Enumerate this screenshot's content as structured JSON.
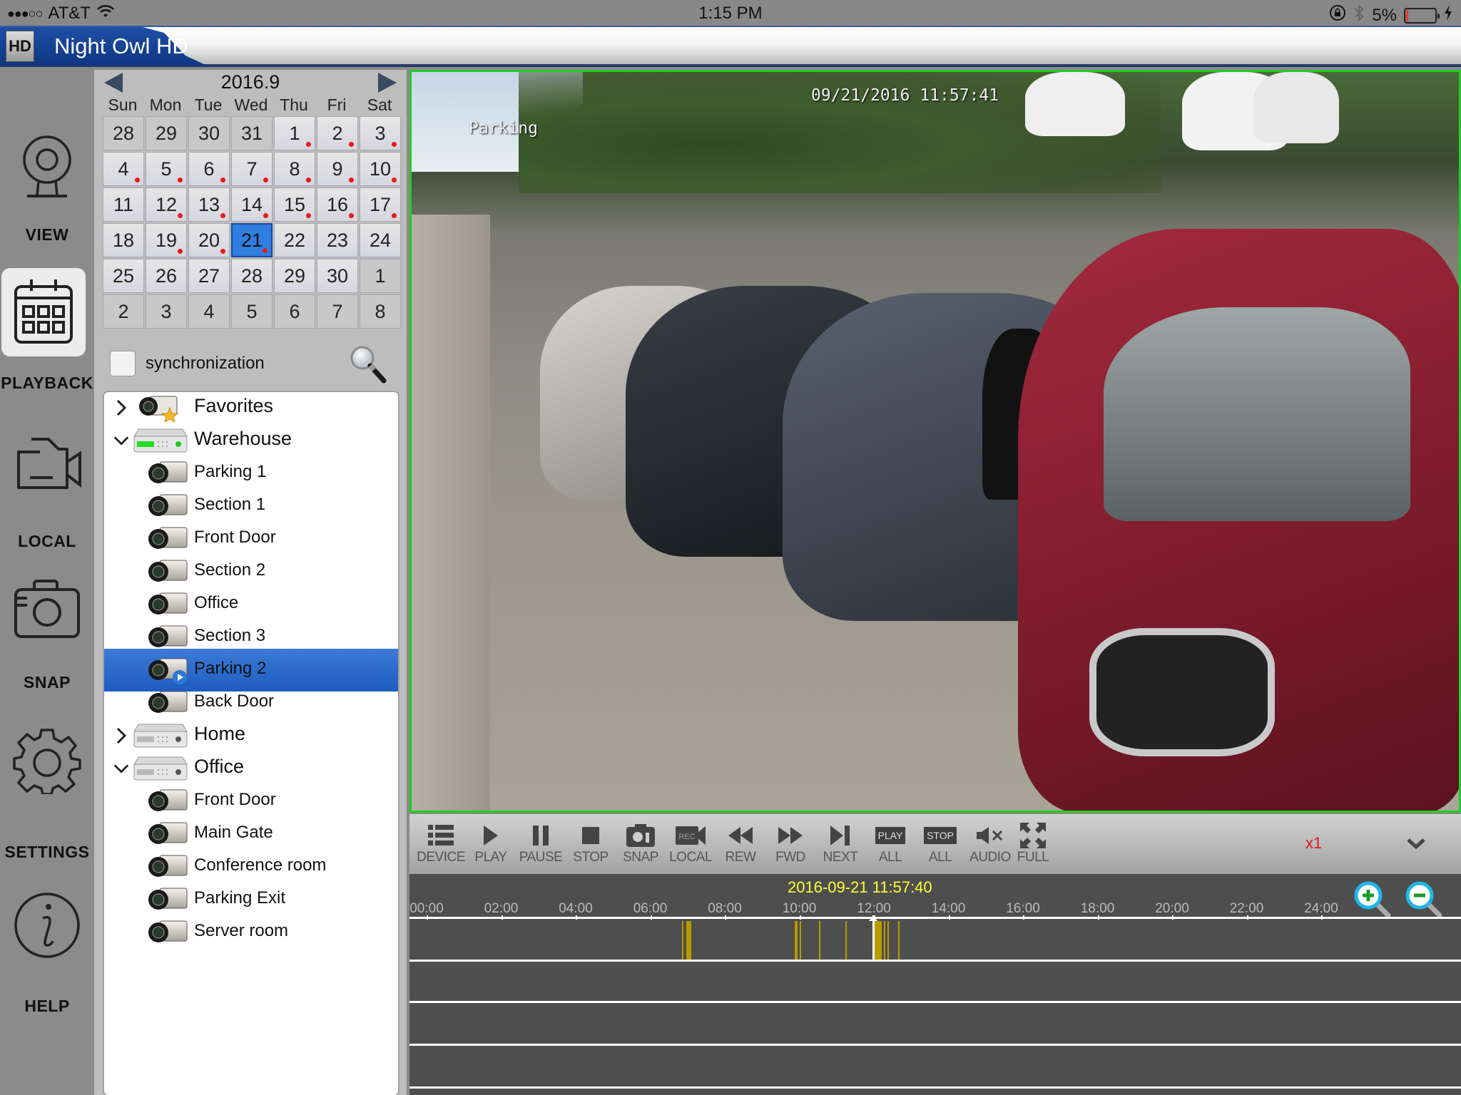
{
  "status_bar": {
    "signal": "●●●○○",
    "carrier": "AT&T",
    "wifi_icon": "wifi-icon",
    "time": "1:15 PM",
    "rotation_lock_icon": "rotation-lock-icon",
    "bluetooth_icon": "bluetooth-icon",
    "battery_percent": "5%",
    "battery_level": 0.05,
    "charging_icon": "charging-bolt-icon"
  },
  "app": {
    "title": "Night Owl HD",
    "logo_text": "HD"
  },
  "nav": {
    "items": [
      {
        "id": "view",
        "label": "VIEW",
        "icon": "webcam-icon",
        "active": false
      },
      {
        "id": "playback",
        "label": "PLAYBACK",
        "icon": "calendar-icon",
        "active": true
      },
      {
        "id": "local",
        "label": "LOCAL",
        "icon": "video-folder-icon",
        "active": false
      },
      {
        "id": "snap",
        "label": "SNAP",
        "icon": "camera-icon",
        "active": false
      },
      {
        "id": "settings",
        "label": "SETTINGS",
        "icon": "gear-icon",
        "active": false
      },
      {
        "id": "help",
        "label": "HELP",
        "icon": "info-icon",
        "active": false
      }
    ]
  },
  "calendar": {
    "title": "2016.9",
    "days_of_week": [
      "Sun",
      "Mon",
      "Tue",
      "Wed",
      "Thu",
      "Fri",
      "Sat"
    ],
    "selected_day": 21,
    "weeks": [
      [
        {
          "d": "28",
          "o": true
        },
        {
          "d": "29",
          "o": true
        },
        {
          "d": "30",
          "o": true
        },
        {
          "d": "31",
          "o": true
        },
        {
          "d": "1",
          "r": true
        },
        {
          "d": "2",
          "r": true
        },
        {
          "d": "3",
          "r": true
        }
      ],
      [
        {
          "d": "4",
          "r": true
        },
        {
          "d": "5",
          "r": true
        },
        {
          "d": "6",
          "r": true
        },
        {
          "d": "7",
          "r": true
        },
        {
          "d": "8",
          "r": true
        },
        {
          "d": "9",
          "r": true
        },
        {
          "d": "10",
          "r": true
        }
      ],
      [
        {
          "d": "11"
        },
        {
          "d": "12",
          "r": true
        },
        {
          "d": "13",
          "r": true
        },
        {
          "d": "14",
          "r": true
        },
        {
          "d": "15",
          "r": true
        },
        {
          "d": "16",
          "r": true
        },
        {
          "d": "17",
          "r": true
        }
      ],
      [
        {
          "d": "18"
        },
        {
          "d": "19",
          "r": true
        },
        {
          "d": "20",
          "r": true
        },
        {
          "d": "21",
          "r": true,
          "s": true
        },
        {
          "d": "22"
        },
        {
          "d": "23"
        },
        {
          "d": "24"
        }
      ],
      [
        {
          "d": "25"
        },
        {
          "d": "26"
        },
        {
          "d": "27"
        },
        {
          "d": "28"
        },
        {
          "d": "29"
        },
        {
          "d": "30"
        },
        {
          "d": "1",
          "o": true
        }
      ],
      [
        {
          "d": "2",
          "o": true
        },
        {
          "d": "3",
          "o": true
        },
        {
          "d": "4",
          "o": true
        },
        {
          "d": "5",
          "o": true
        },
        {
          "d": "6",
          "o": true
        },
        {
          "d": "7",
          "o": true
        },
        {
          "d": "8",
          "o": true
        }
      ]
    ]
  },
  "sync": {
    "label": "synchronization",
    "checked": false
  },
  "device_tree": {
    "rows": [
      {
        "type": "group",
        "label": "Favorites",
        "icon": "favorites-camera-icon",
        "expanded": false
      },
      {
        "type": "group",
        "label": "Warehouse",
        "icon": "dvr-online-icon",
        "expanded": true
      },
      {
        "type": "camera",
        "label": "Parking 1"
      },
      {
        "type": "camera",
        "label": "Section 1"
      },
      {
        "type": "camera",
        "label": "Front Door"
      },
      {
        "type": "camera",
        "label": "Section 2"
      },
      {
        "type": "camera",
        "label": "Office"
      },
      {
        "type": "camera",
        "label": "Section 3"
      },
      {
        "type": "camera",
        "label": "Parking 2",
        "selected": true,
        "playing": true
      },
      {
        "type": "camera",
        "label": "Back Door"
      },
      {
        "type": "group",
        "label": "Home",
        "icon": "dvr-icon",
        "expanded": false
      },
      {
        "type": "group",
        "label": "Office",
        "icon": "dvr-icon",
        "expanded": true
      },
      {
        "type": "camera",
        "label": "Front Door"
      },
      {
        "type": "camera",
        "label": "Main Gate"
      },
      {
        "type": "camera",
        "label": "Conference room"
      },
      {
        "type": "camera",
        "label": "Parking Exit"
      },
      {
        "type": "camera",
        "label": "Server room"
      }
    ]
  },
  "video": {
    "osd_timestamp": "09/21/2016 11:57:41",
    "osd_channel": "Parking",
    "border_color": "#22cc22"
  },
  "toolbar": {
    "buttons": [
      {
        "id": "device",
        "label": "DEVICE",
        "icon": "list-icon"
      },
      {
        "id": "play",
        "label": "PLAY",
        "icon": "play-icon"
      },
      {
        "id": "pause",
        "label": "PAUSE",
        "icon": "pause-icon"
      },
      {
        "id": "stop",
        "label": "STOP",
        "icon": "stop-icon"
      },
      {
        "id": "snap",
        "label": "SNAP",
        "icon": "snapshot-camera-icon"
      },
      {
        "id": "local",
        "label": "LOCAL",
        "icon": "rec-camera-icon",
        "badge": "REC"
      },
      {
        "id": "rew",
        "label": "REW",
        "icon": "rewind-icon"
      },
      {
        "id": "fwd",
        "label": "FWD",
        "icon": "fast-forward-icon"
      },
      {
        "id": "next",
        "label": "NEXT",
        "icon": "next-frame-icon"
      },
      {
        "id": "play_all",
        "label": "ALL",
        "icon": "play-all-icon",
        "badge": "PLAY"
      },
      {
        "id": "stop_all",
        "label": "ALL",
        "icon": "stop-all-icon",
        "badge": "STOP"
      },
      {
        "id": "audio",
        "label": "AUDIO",
        "icon": "mute-icon"
      },
      {
        "id": "full",
        "label": "FULL",
        "icon": "fullscreen-icon"
      }
    ],
    "speed": "x1",
    "collapse_icon": "chevron-down-icon"
  },
  "timeline": {
    "current_time": "2016-09-21 11:57:40",
    "hour_labels": [
      "00:00",
      "02:00",
      "04:00",
      "06:00",
      "08:00",
      "10:00",
      "12:00",
      "14:00",
      "16:00",
      "18:00",
      "20:00",
      "22:00",
      "24:00"
    ],
    "range_hours": [
      0,
      24
    ],
    "playhead_hour": 11.961,
    "record_color": "#b89a00",
    "recordings": [
      {
        "start": 6.86,
        "end": 6.89
      },
      {
        "start": 6.97,
        "end": 7.11
      },
      {
        "start": 9.87,
        "end": 9.95
      },
      {
        "start": 10.0,
        "end": 10.03
      },
      {
        "start": 10.52,
        "end": 10.55
      },
      {
        "start": 11.23,
        "end": 11.26
      },
      {
        "start": 11.98,
        "end": 12.22
      },
      {
        "start": 12.26,
        "end": 12.29
      },
      {
        "start": 12.36,
        "end": 12.39
      },
      {
        "start": 12.66,
        "end": 12.69
      }
    ],
    "track_count": 4,
    "zoom_in_icon": "zoom-in-icon",
    "zoom_out_icon": "zoom-out-icon"
  }
}
